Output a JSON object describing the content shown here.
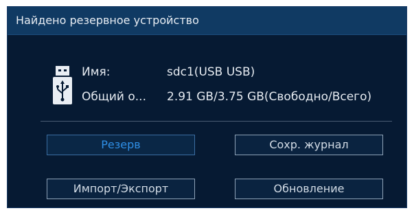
{
  "dialog": {
    "title": "Найдено резервное устройство"
  },
  "device": {
    "icon": "usb-flash-drive-icon",
    "name_label": "Имя:",
    "name_value": "sdc1(USB USB)",
    "capacity_label": "Общий о...",
    "capacity_value": "2.91 GB/3.75 GB(Свободно/Всего)"
  },
  "buttons": {
    "backup": "Резерв",
    "save_log": "Сохр. журнал",
    "import_export": "Импорт/Экспорт",
    "update": "Обновление"
  },
  "colors": {
    "background": "#061a33",
    "titlebar": "#103a63",
    "accent": "#2f8fe6",
    "text": "#e6ebf1"
  }
}
